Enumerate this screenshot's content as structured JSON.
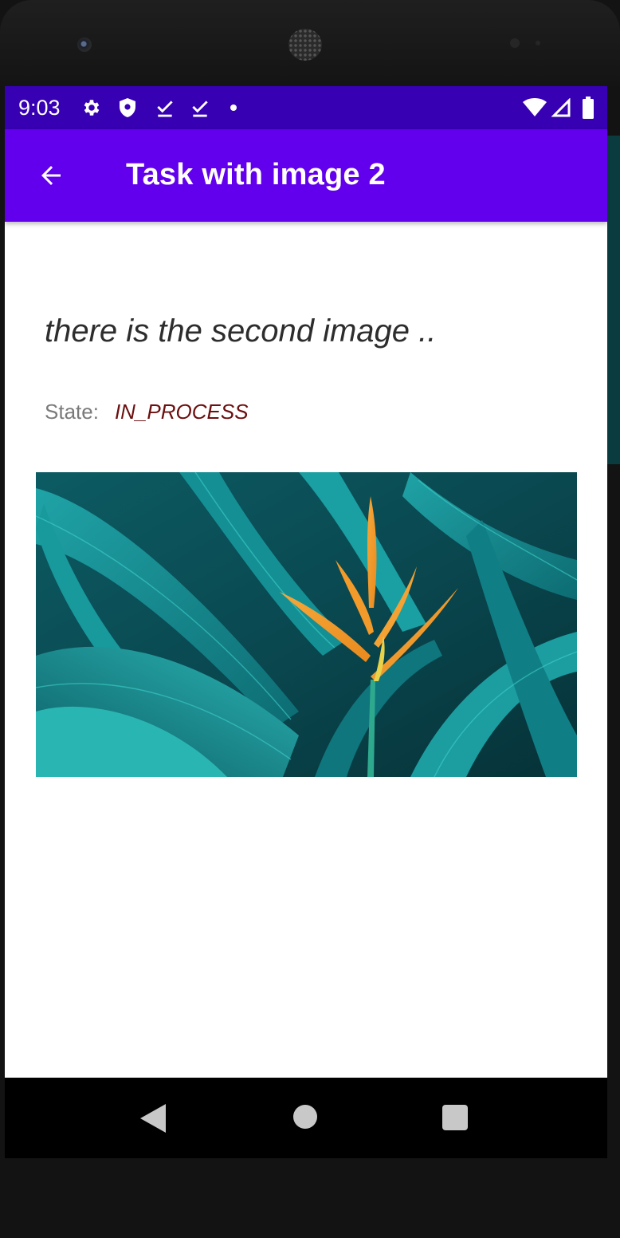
{
  "status_bar": {
    "time": "9:03",
    "icons": [
      "settings-icon",
      "shield-icon",
      "download-done-icon",
      "download-done-icon",
      "dot-icon"
    ],
    "right_icons": [
      "wifi-icon",
      "signal-icon",
      "battery-icon"
    ]
  },
  "app_bar": {
    "title": "Task with image 2",
    "back_icon": "arrow-back-icon"
  },
  "task": {
    "description": "there is the second image ..",
    "state_label": "State:",
    "state_value": "IN_PROCESS"
  },
  "nav_bar": {
    "buttons": [
      "back-triangle-icon",
      "home-circle-icon",
      "recents-square-icon"
    ]
  },
  "colors": {
    "status_bar": "#3700b3",
    "app_bar": "#6200ee",
    "state_value": "#6b0f0f"
  }
}
